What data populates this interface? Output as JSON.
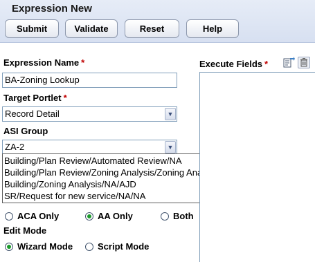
{
  "header": {
    "title": "Expression New",
    "buttons": {
      "submit": "Submit",
      "validate": "Validate",
      "reset": "Reset",
      "help": "Help"
    }
  },
  "form": {
    "expression_name": {
      "label": "Expression Name",
      "required": "*",
      "value": "BA-Zoning Lookup"
    },
    "target_portlet": {
      "label": "Target Portlet",
      "required": "*",
      "value": "Record Detail"
    },
    "asi_group": {
      "label": "ASI Group",
      "value": "ZA-2",
      "options": [
        "Building/Plan Review/Automated Review/NA",
        "Building/Plan Review/Zoning Analysis/Zoning Analysis",
        "Building/Zoning Analysis/NA/AJD",
        "SR/Request for new service/NA/NA"
      ]
    },
    "portal_options": [
      {
        "label": "ACA Only",
        "checked": false
      },
      {
        "label": "AA Only",
        "checked": true
      },
      {
        "label": "Both",
        "checked": false
      }
    ],
    "edit_mode": {
      "label": "Edit Mode",
      "options": [
        {
          "label": "Wizard Mode",
          "checked": true
        },
        {
          "label": "Script Mode",
          "checked": false
        }
      ]
    }
  },
  "execute_fields": {
    "label": "Execute Fields",
    "required": "*",
    "icons": [
      "add-field-icon",
      "delete-icon"
    ]
  },
  "colors": {
    "header_bg": "#dde4f4",
    "required": "#c00000",
    "radio_fill": "#1a9a2a"
  }
}
